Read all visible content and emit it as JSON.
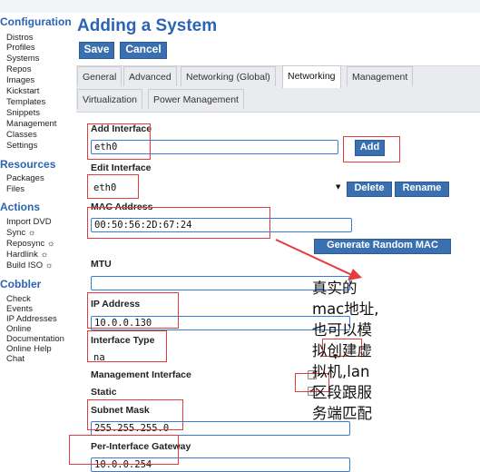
{
  "sidebar": {
    "configuration_title": "Configuration",
    "configuration_items": [
      "Distros",
      "Profiles",
      "Systems",
      "Repos",
      "Images",
      "Kickstart",
      "Templates",
      "Snippets",
      "Management",
      "Classes",
      "Settings"
    ],
    "resources_title": "Resources",
    "resources_items": [
      "Packages",
      "Files"
    ],
    "actions_title": "Actions",
    "actions_items": [
      "Import DVD",
      "Sync ☼",
      "Reposync ☼",
      "Hardlink ☼",
      "Build ISO ☼"
    ],
    "cobbler_title": "Cobbler",
    "cobbler_items": [
      "Check",
      "Events",
      "IP Addresses",
      "Online",
      "Documentation",
      "Online Help",
      "Chat"
    ]
  },
  "page": {
    "title": "Adding a System",
    "save_label": "Save",
    "cancel_label": "Cancel"
  },
  "tabs": {
    "row1": [
      "General",
      "Advanced",
      "Networking (Global)",
      "Networking",
      "Management"
    ],
    "row2": [
      "Virtualization",
      "Power Management"
    ],
    "active": "Networking"
  },
  "form": {
    "add_interface_label": "Add Interface",
    "add_interface_value": "eth0",
    "add_button": "Add",
    "edit_interface_label": "Edit Interface",
    "edit_interface_value": "eth0",
    "delete_button": "Delete",
    "rename_button": "Rename",
    "mac_label": "MAC Address",
    "mac_value": "00:50:56:2D:67:24",
    "generate_mac_button": "Generate Random MAC",
    "mtu_label": "MTU",
    "mtu_value": "",
    "ip_label": "IP Address",
    "ip_value": "10.0.0.130",
    "interface_type_label": "Interface Type",
    "interface_type_value": "na",
    "management_interface_label": "Management Interface",
    "management_interface_checked": false,
    "static_label": "Static",
    "static_checked": true,
    "subnet_label": "Subnet Mask",
    "subnet_value": "255.255.255.0",
    "gateway_label": "Per-Interface Gateway",
    "gateway_value": "10.0.0.254"
  },
  "annotation": {
    "text_lines": [
      "真实的",
      "mac地址,",
      "也可以模",
      "拟创建虚",
      "拟机,lan",
      "区段跟服",
      "务端匹配"
    ],
    "color": "#e43c3c"
  }
}
